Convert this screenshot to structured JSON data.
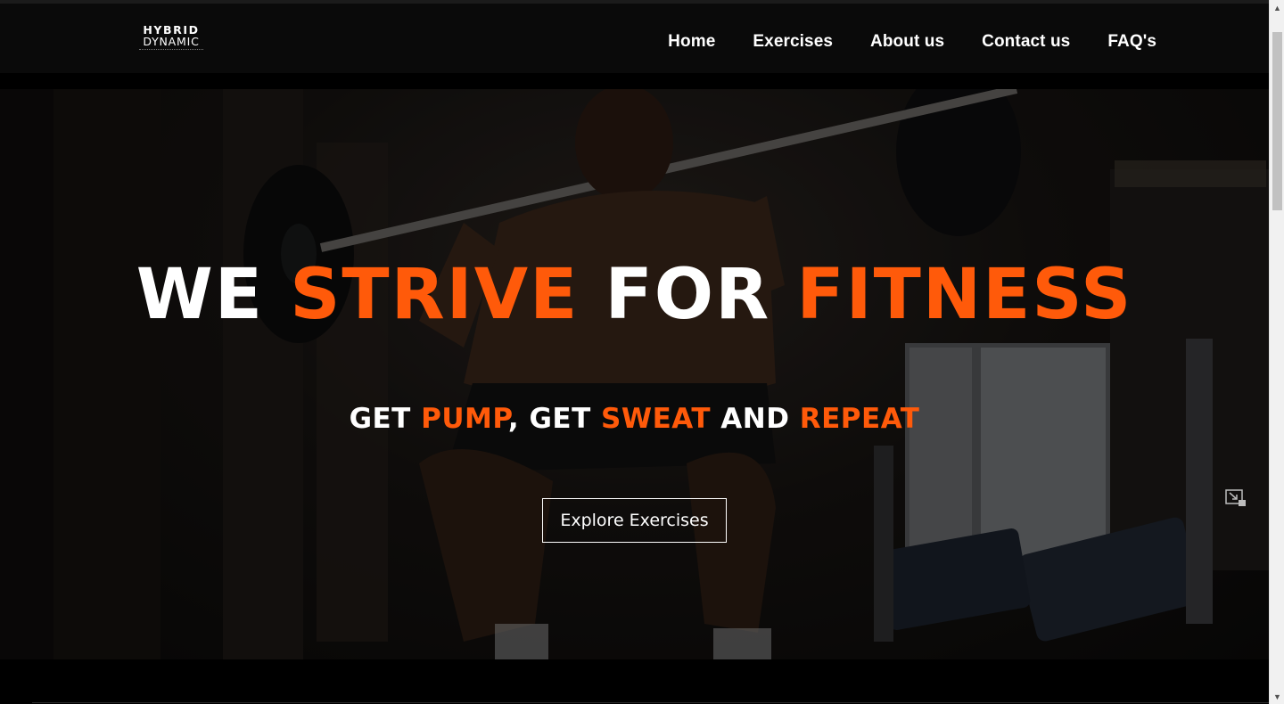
{
  "brand": {
    "line1": "HYBRID",
    "line2": "DYNAMIC"
  },
  "nav": {
    "items": [
      {
        "label": "Home"
      },
      {
        "label": "Exercises"
      },
      {
        "label": "About us"
      },
      {
        "label": "Contact us"
      },
      {
        "label": "FAQ's"
      }
    ]
  },
  "hero": {
    "title": [
      {
        "text": "WE ",
        "accent": false
      },
      {
        "text": "STRIVE",
        "accent": true
      },
      {
        "text": " FOR ",
        "accent": false
      },
      {
        "text": "FITNESS",
        "accent": true
      }
    ],
    "subtitle": [
      {
        "text": "GET ",
        "accent": false
      },
      {
        "text": "PUMP",
        "accent": true
      },
      {
        "text": ", GET ",
        "accent": false
      },
      {
        "text": "SWEAT",
        "accent": true
      },
      {
        "text": " AND ",
        "accent": false
      },
      {
        "text": "REPEAT",
        "accent": true
      }
    ],
    "cta_label": "Explore Exercises"
  },
  "colors": {
    "accent": "#ff5a0a",
    "navbar": "#0a0a0a",
    "text": "#ffffff"
  },
  "icons": {
    "pip": "picture-in-picture-icon",
    "scroll_up": "scroll-up-arrow-icon",
    "scroll_down": "scroll-down-arrow-icon"
  }
}
